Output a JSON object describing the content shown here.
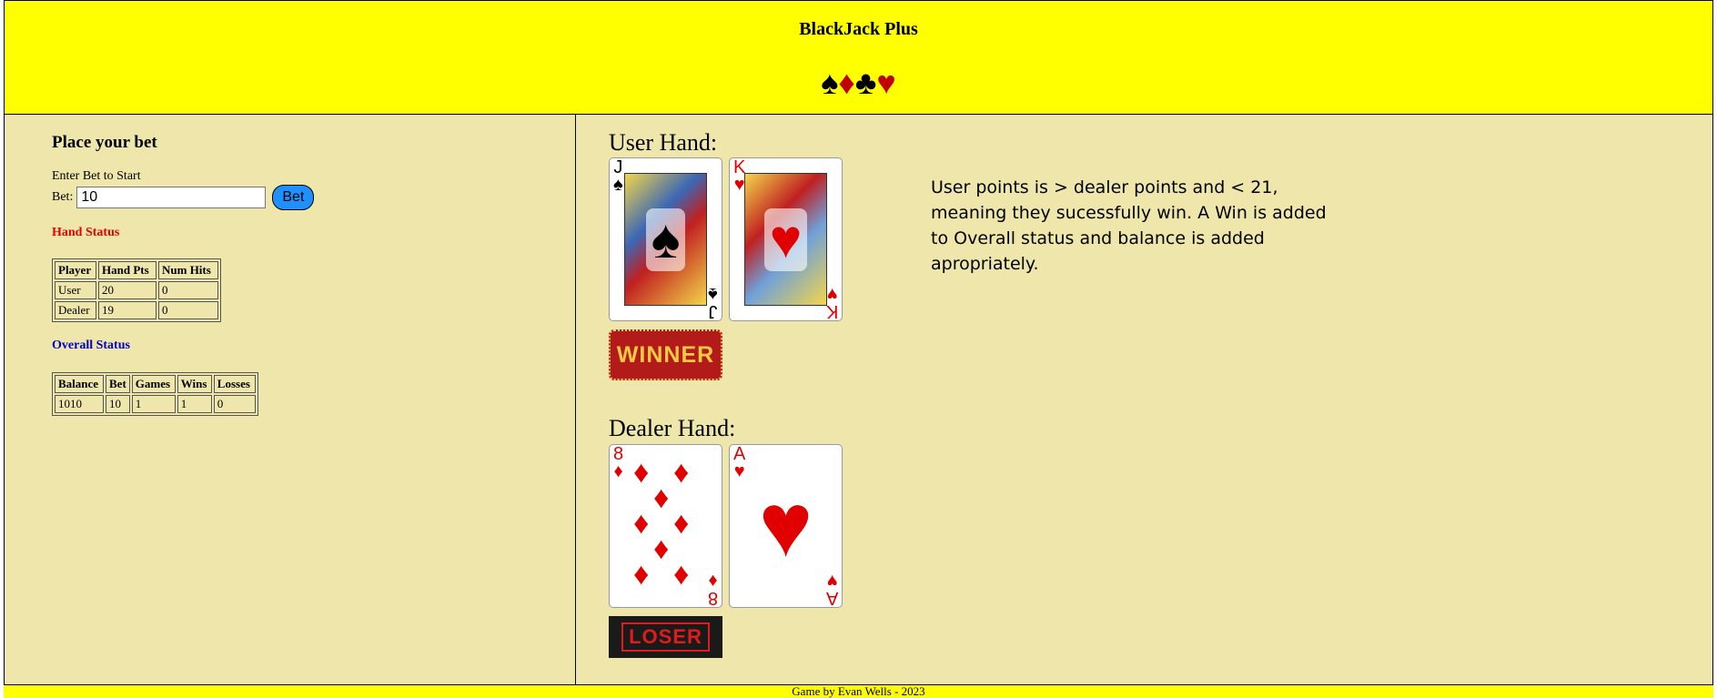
{
  "header": {
    "title": "BlackJack Plus",
    "suits": [
      "♠",
      "♦",
      "♣",
      "♥"
    ]
  },
  "bet_panel": {
    "heading": "Place your bet",
    "instruction": "Enter Bet to Start",
    "bet_label": "Bet:",
    "bet_value": "10",
    "bet_button": "Bet"
  },
  "hand_status": {
    "label": "Hand Status",
    "headers": [
      "Player",
      "Hand Pts",
      "Num Hits"
    ],
    "rows": [
      [
        "User",
        "20",
        "0"
      ],
      [
        "Dealer",
        "19",
        "0"
      ]
    ]
  },
  "overall_status": {
    "label": "Overall Status",
    "headers": [
      "Balance",
      "Bet",
      "Games",
      "Wins",
      "Losses"
    ],
    "row": [
      "1010",
      "10",
      "1",
      "1",
      "0"
    ]
  },
  "user_hand": {
    "heading": "User Hand:",
    "cards": [
      {
        "rank": "J",
        "suit": "♠",
        "color": "#000000",
        "type": "face"
      },
      {
        "rank": "K",
        "suit": "♥",
        "color": "#e00000",
        "type": "face"
      }
    ],
    "result": "WINNER"
  },
  "dealer_hand": {
    "heading": "Dealer Hand:",
    "cards": [
      {
        "rank": "8",
        "suit": "♦",
        "color": "#e00000",
        "type": "pips"
      },
      {
        "rank": "A",
        "suit": "♥",
        "color": "#e00000",
        "type": "ace"
      }
    ],
    "result": "LOSER"
  },
  "explanation": "User points is > dealer points and < 21, meaning they sucessfully win. A Win is added to Overall status and balance is added apropriately.",
  "footer": "Game by Evan Wells - 2023",
  "colors": {
    "header_bg": "#ffff00",
    "panel_bg": "#eee6aa",
    "bet_button": "#1e90ff",
    "hand_status_label": "#e60000",
    "overall_status_label": "#0000cc"
  }
}
